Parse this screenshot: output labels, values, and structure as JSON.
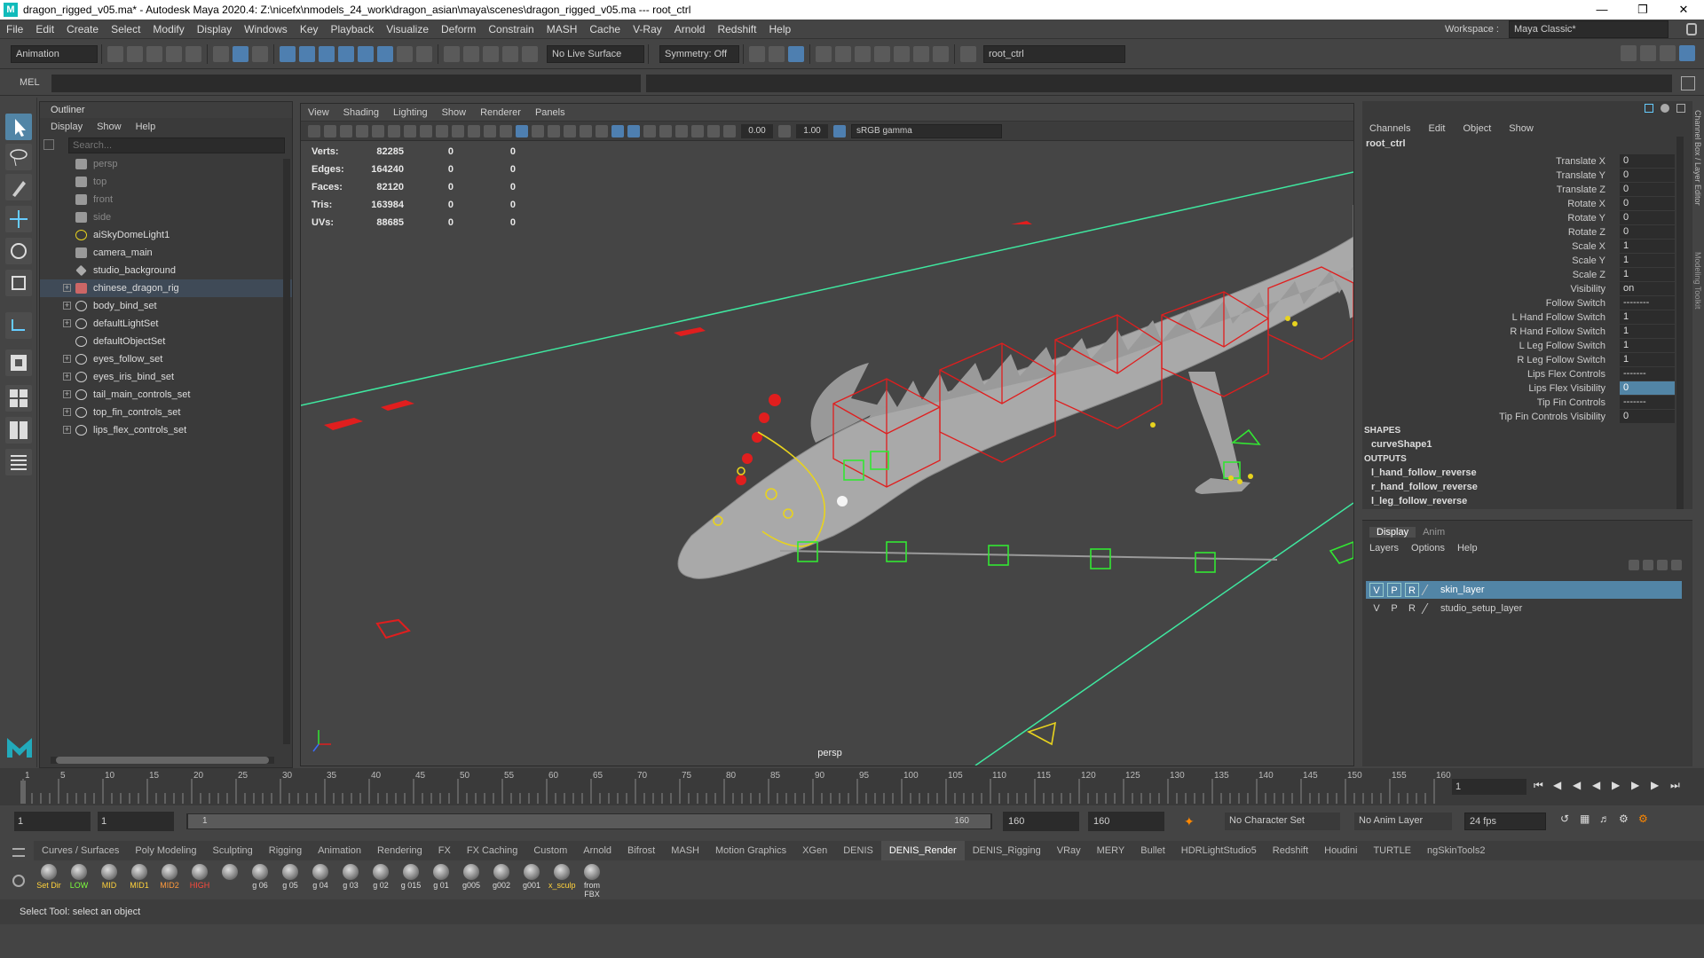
{
  "window": {
    "title": "dragon_rigged_v05.ma* - Autodesk Maya 2020.4: Z:\\nicefx\\nmodels_24_work\\dragon_asian\\maya\\scenes\\dragon_rigged_v05.ma  ---  root_ctrl",
    "logo": "M"
  },
  "menu": [
    "File",
    "Edit",
    "Create",
    "Select",
    "Modify",
    "Display",
    "Windows",
    "Key",
    "Playback",
    "Visualize",
    "Deform",
    "Constrain",
    "MASH",
    "Cache",
    "V-Ray",
    "Arnold",
    "Redshift",
    "Help"
  ],
  "workspace": {
    "label": "Workspace :",
    "value": "Maya Classic*"
  },
  "statusline": {
    "mode": "Animation",
    "live_surface": "No Live Surface",
    "symmetry": "Symmetry: Off",
    "object_field": "root_ctrl"
  },
  "mel": {
    "label": "MEL"
  },
  "outliner": {
    "title": "Outliner",
    "menu": [
      "Display",
      "Show",
      "Help"
    ],
    "search_placeholder": "Search...",
    "items": [
      {
        "label": "persp",
        "icon": "camera-icon",
        "dim": true,
        "expand": ""
      },
      {
        "label": "top",
        "icon": "camera-icon",
        "dim": true,
        "expand": ""
      },
      {
        "label": "front",
        "icon": "camera-icon",
        "dim": true,
        "expand": ""
      },
      {
        "label": "side",
        "icon": "camera-icon",
        "dim": true,
        "expand": ""
      },
      {
        "label": "aiSkyDomeLight1",
        "icon": "light-icon",
        "dim": false,
        "expand": ""
      },
      {
        "label": "camera_main",
        "icon": "camera-icon",
        "dim": false,
        "expand": ""
      },
      {
        "label": "studio_background",
        "icon": "mesh-icon",
        "dim": false,
        "expand": ""
      },
      {
        "label": "chinese_dragon_rig",
        "icon": "rig-icon",
        "dim": false,
        "expand": "+",
        "selected": true
      },
      {
        "label": "body_bind_set",
        "icon": "set-icon",
        "dim": false,
        "expand": "+"
      },
      {
        "label": "defaultLightSet",
        "icon": "set-icon",
        "dim": false,
        "expand": "+"
      },
      {
        "label": "defaultObjectSet",
        "icon": "set-icon",
        "dim": false,
        "expand": ""
      },
      {
        "label": "eyes_follow_set",
        "icon": "set-icon",
        "dim": false,
        "expand": "+"
      },
      {
        "label": "eyes_iris_bind_set",
        "icon": "set-icon",
        "dim": false,
        "expand": "+"
      },
      {
        "label": "tail_main_controls_set",
        "icon": "set-icon",
        "dim": false,
        "expand": "+"
      },
      {
        "label": "top_fin_controls_set",
        "icon": "set-icon",
        "dim": false,
        "expand": "+"
      },
      {
        "label": "lips_flex_controls_set",
        "icon": "set-icon",
        "dim": false,
        "expand": "+"
      }
    ]
  },
  "viewport": {
    "menu": [
      "View",
      "Shading",
      "Lighting",
      "Show",
      "Renderer",
      "Panels"
    ],
    "exposure": "0.00",
    "gamma": "1.00",
    "colorspace": "sRGB gamma",
    "camera_label": "persp",
    "hud": [
      {
        "label": "Verts:",
        "v": "82285",
        "a": "0",
        "b": "0"
      },
      {
        "label": "Edges:",
        "v": "164240",
        "a": "0",
        "b": "0"
      },
      {
        "label": "Faces:",
        "v": "82120",
        "a": "0",
        "b": "0"
      },
      {
        "label": "Tris:",
        "v": "163984",
        "a": "0",
        "b": "0"
      },
      {
        "label": "UVs:",
        "v": "88685",
        "a": "0",
        "b": "0"
      }
    ]
  },
  "channelbox": {
    "menu": [
      "Channels",
      "Edit",
      "Object",
      "Show"
    ],
    "object": "root_ctrl",
    "channels": [
      {
        "label": "Translate X",
        "value": "0"
      },
      {
        "label": "Translate Y",
        "value": "0"
      },
      {
        "label": "Translate Z",
        "value": "0"
      },
      {
        "label": "Rotate X",
        "value": "0"
      },
      {
        "label": "Rotate Y",
        "value": "0"
      },
      {
        "label": "Rotate Z",
        "value": "0"
      },
      {
        "label": "Scale X",
        "value": "1"
      },
      {
        "label": "Scale Y",
        "value": "1"
      },
      {
        "label": "Scale Z",
        "value": "1"
      },
      {
        "label": "Visibility",
        "value": "on"
      },
      {
        "label": "Follow Switch",
        "value": "--------"
      },
      {
        "label": "L Hand Follow Switch",
        "value": "1"
      },
      {
        "label": "R Hand Follow Switch",
        "value": "1"
      },
      {
        "label": "L Leg Follow Switch",
        "value": "1"
      },
      {
        "label": "R Leg Follow Switch",
        "value": "1"
      },
      {
        "label": "Lips Flex Controls",
        "value": "-------"
      },
      {
        "label": "Lips Flex Visibility",
        "value": "0",
        "hl": true
      },
      {
        "label": "Tip Fin Controls",
        "value": "-------"
      },
      {
        "label": "Tip Fin Controls Visibility",
        "value": "0"
      }
    ],
    "shapes_header": "SHAPES",
    "shape": "curveShape1",
    "outputs_header": "OUTPUTS",
    "outputs": [
      "l_hand_follow_reverse",
      "r_hand_follow_reverse",
      "l_leg_follow_reverse"
    ],
    "side_labels": [
      "Channel Box / Layer Editor",
      "Modeling Toolkit"
    ]
  },
  "layers": {
    "tabs": [
      "Display",
      "Anim"
    ],
    "menu": [
      "Layers",
      "Options",
      "Help"
    ],
    "rows": [
      {
        "v": "V",
        "p": "P",
        "r": "R",
        "name": "skin_layer",
        "sel": true
      },
      {
        "v": "V",
        "p": "P",
        "r": "R",
        "name": "studio_setup_layer",
        "sel": false
      }
    ]
  },
  "timeline": {
    "ticks": [
      "1",
      "5",
      "10",
      "15",
      "20",
      "25",
      "30",
      "35",
      "40",
      "45",
      "50",
      "55",
      "60",
      "65",
      "70",
      "75",
      "80",
      "85",
      "90",
      "95",
      "100",
      "105",
      "110",
      "115",
      "120",
      "125",
      "130",
      "135",
      "140",
      "145",
      "150",
      "155",
      "160"
    ],
    "current": "1"
  },
  "range": {
    "start": "1",
    "anim_start": "1",
    "slider_start": "1",
    "slider_end": "160",
    "anim_end": "160",
    "end": "160",
    "char_set": "No Character Set",
    "anim_layer": "No Anim Layer",
    "fps": "24 fps"
  },
  "shelf": {
    "tabs": [
      "Curves / Surfaces",
      "Poly Modeling",
      "Sculpting",
      "Rigging",
      "Animation",
      "Rendering",
      "FX",
      "FX Caching",
      "Custom",
      "Arnold",
      "Bifrost",
      "MASH",
      "Motion Graphics",
      "XGen",
      "DENIS",
      "DENIS_Render",
      "DENIS_Rigging",
      "VRay",
      "MERY",
      "Bullet",
      "HDRLightStudio5",
      "Redshift",
      "Houdini",
      "TURTLE",
      "ngSkinTools2"
    ],
    "active": "DENIS_Render",
    "buttons": [
      {
        "label": "Set Dir",
        "color": "#ffd23c"
      },
      {
        "label": "LOW",
        "color": "#7cff3c"
      },
      {
        "label": "MID",
        "color": "#ffd23c"
      },
      {
        "label": "MID1",
        "color": "#ffd23c"
      },
      {
        "label": "MID2",
        "color": "#ff9a3c"
      },
      {
        "label": "HIGH",
        "color": "#ff4a3c"
      },
      {
        "label": "",
        "color": "#ddd"
      },
      {
        "label": "g 06",
        "color": "#ddd"
      },
      {
        "label": "g 05",
        "color": "#ddd"
      },
      {
        "label": "g 04",
        "color": "#ddd"
      },
      {
        "label": "g 03",
        "color": "#ddd"
      },
      {
        "label": "g 02",
        "color": "#ddd"
      },
      {
        "label": "g 015",
        "color": "#ddd"
      },
      {
        "label": "g 01",
        "color": "#ddd"
      },
      {
        "label": "g005",
        "color": "#ddd"
      },
      {
        "label": "g002",
        "color": "#ddd"
      },
      {
        "label": "g001",
        "color": "#ddd"
      },
      {
        "label": "x_sculp",
        "color": "#ffd23c"
      },
      {
        "label": "from FBX",
        "color": "#ddd"
      }
    ]
  },
  "help_line": "Select Tool: select an object"
}
